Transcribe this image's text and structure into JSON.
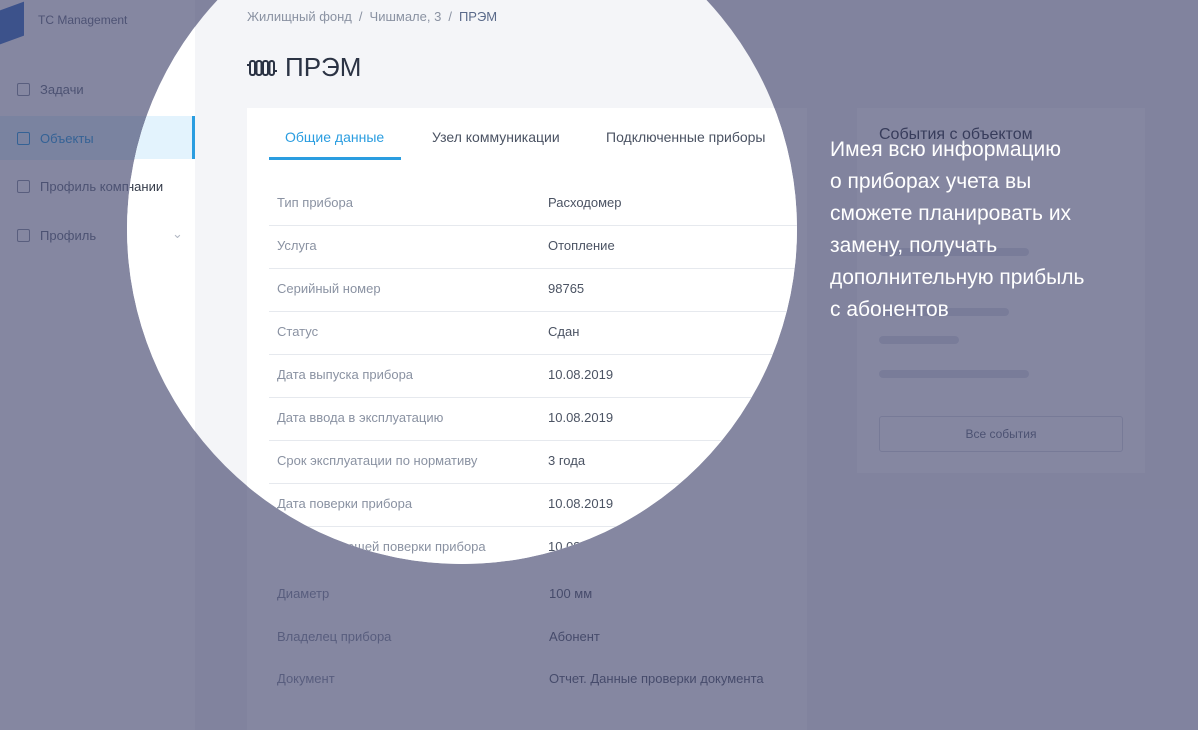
{
  "app": {
    "logo_text": "TC Management",
    "sidebar": {
      "items": [
        {
          "label": "Задачи"
        },
        {
          "label": "Объекты"
        },
        {
          "label": "Профиль компании"
        },
        {
          "label": "Профиль"
        }
      ]
    }
  },
  "breadcrumb": [
    "Жилищный фонд",
    "Чишмале, 3",
    "ПРЭМ"
  ],
  "breadcrumb_separator": "/",
  "page_title": "ПРЭМ",
  "tabs": [
    "Общие данные",
    "Узел коммуникации",
    "Подключенные приборы"
  ],
  "details": [
    {
      "label": "Тип прибора",
      "value": "Расходомер"
    },
    {
      "label": "Услуга",
      "value": "Отопление"
    },
    {
      "label": "Серийный номер",
      "value": "98765"
    },
    {
      "label": "Статус",
      "value": "Сдан"
    },
    {
      "label": "Дата выпуска прибора",
      "value": "10.08.2019"
    },
    {
      "label": "Дата ввода в эксплуатацию",
      "value": "10.08.2019"
    },
    {
      "label": "Срок эксплуатации по нормативу",
      "value": "3 года"
    },
    {
      "label": "Дата поверки прибора",
      "value": "10.08.2019"
    },
    {
      "label": "Дата следующей поверки прибора",
      "value": "10.08.2020"
    }
  ],
  "background_rows": [
    {
      "label": "Диаметр",
      "value": "100 мм"
    },
    {
      "label": "Владелец прибора",
      "value": "Абонент"
    },
    {
      "label": "Документ",
      "value": "Отчет. Данные проверки документа"
    }
  ],
  "events_panel": {
    "title": "События с объектом",
    "button": "Все события"
  },
  "promo_lines": [
    "Имея всю информацию",
    "о приборах учета вы",
    "сможете планировать их",
    "замену, получать",
    "дополнительную прибыль",
    "с абонентов"
  ],
  "colors": {
    "accent": "#2a9de0",
    "overlay": "#3a3d68"
  }
}
